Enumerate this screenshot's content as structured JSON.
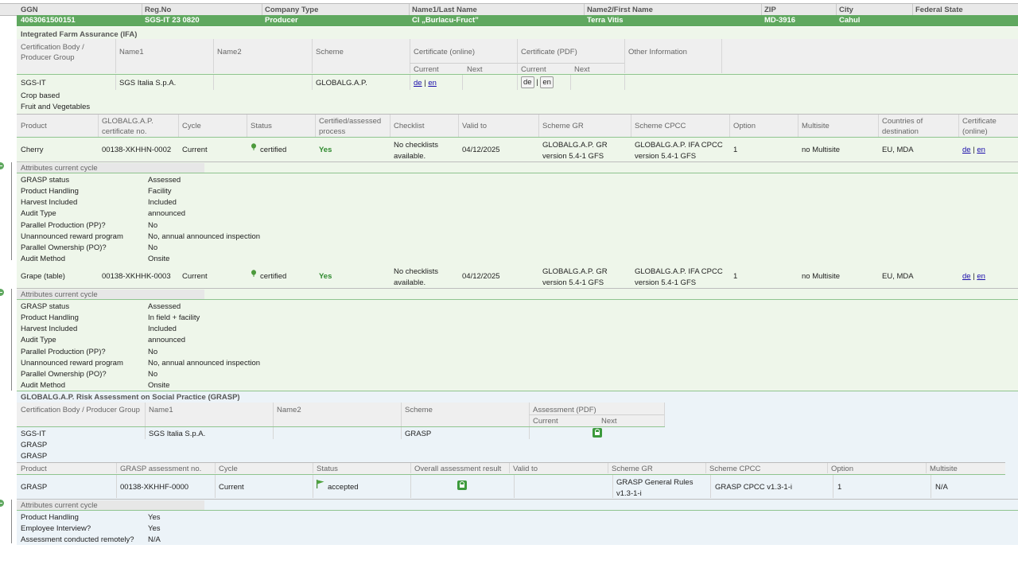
{
  "header": {
    "cols": [
      "GGN",
      "Reg.No",
      "Company Type",
      "Name1/Last Name",
      "Name2/First Name",
      "ZIP",
      "City",
      "Federal State"
    ]
  },
  "record": {
    "ggn": "4063061500151",
    "reg_no": "SGS-IT 23 0820",
    "company_type": "Producer",
    "name1": "CI „Burlacu-Fruct”",
    "name2": "Terra Vitis",
    "zip": "MD-3916",
    "city": "Cahul",
    "federal_state": ""
  },
  "ifa": {
    "title": "Integrated Farm Assurance (IFA)",
    "cols": {
      "cert_body": "Certification Body / Producer Group",
      "name1": "Name1",
      "name2": "Name2",
      "scheme": "Scheme",
      "cert_online": "Certificate (online)",
      "cert_pdf": "Certificate (PDF)",
      "other": "Other Information",
      "current": "Current",
      "next": "Next"
    },
    "row": {
      "cert_body": "SGS-IT",
      "name1": "SGS Italia S.p.A.",
      "name2": "",
      "scheme": "GLOBALG.A.P.",
      "online_de": "de",
      "online_en": "en",
      "pdf_de": "de",
      "pdf_en": "en",
      "sep": "|"
    },
    "sub1": "Crop based",
    "sub2": "Fruit and Vegetables",
    "prod_cols": {
      "product": "Product",
      "cert_no": "GLOBALG.A.P. certificate no.",
      "cycle": "Cycle",
      "status": "Status",
      "certified_process": "Certified/assessed process",
      "checklist": "Checklist",
      "valid_to": "Valid to",
      "scheme_gr": "Scheme GR",
      "scheme_cpcc": "Scheme CPCC",
      "option": "Option",
      "multisite": "Multisite",
      "countries": "Countries of destination",
      "certificate": "Certificate (online)"
    },
    "products": [
      {
        "product": "Cherry",
        "cert_no": "00138-XKHHN-0002",
        "cycle": "Current",
        "status": "certified",
        "process": "Yes",
        "checklist": "No checklists available.",
        "valid_to": "04/12/2025",
        "scheme_gr": "GLOBALG.A.P. GR version 5.4-1 GFS",
        "scheme_cpcc": "GLOBALG.A.P. IFA CPCC version 5.4-1 GFS",
        "option": "1",
        "multisite": "no Multisite",
        "countries": "EU, MDA",
        "de": "de",
        "en": "en",
        "sep": "|",
        "attr_title": "Attributes current cycle",
        "attrs": [
          [
            "GRASP status",
            "Assessed"
          ],
          [
            "Product Handling",
            "Facility"
          ],
          [
            "Harvest Included",
            "Included"
          ],
          [
            "Audit Type",
            "announced"
          ],
          [
            "Parallel Production (PP)?",
            "No"
          ],
          [
            "Unannounced reward program",
            "No, annual announced inspection"
          ],
          [
            "Parallel Ownership (PO)?",
            "No"
          ],
          [
            "Audit Method",
            "Onsite"
          ]
        ]
      },
      {
        "product": "Grape (table)",
        "cert_no": "00138-XKHHK-0003",
        "cycle": "Current",
        "status": "certified",
        "process": "Yes",
        "checklist": "No checklists available.",
        "valid_to": "04/12/2025",
        "scheme_gr": "GLOBALG.A.P. GR version 5.4-1 GFS",
        "scheme_cpcc": "GLOBALG.A.P. IFA CPCC version 5.4-1 GFS",
        "option": "1",
        "multisite": "no Multisite",
        "countries": "EU, MDA",
        "de": "de",
        "en": "en",
        "sep": "|",
        "attr_title": "Attributes current cycle",
        "attrs": [
          [
            "GRASP status",
            "Assessed"
          ],
          [
            "Product Handling",
            "In field + facility"
          ],
          [
            "Harvest Included",
            "Included"
          ],
          [
            "Audit Type",
            "announced"
          ],
          [
            "Parallel Production (PP)?",
            "No"
          ],
          [
            "Unannounced reward program",
            "No, annual announced inspection"
          ],
          [
            "Parallel Ownership (PO)?",
            "No"
          ],
          [
            "Audit Method",
            "Onsite"
          ]
        ]
      }
    ]
  },
  "grasp": {
    "title": "GLOBALG.A.P. Risk Assessment on Social Practice (GRASP)",
    "cols": {
      "cert_body": "Certification Body / Producer Group",
      "name1": "Name1",
      "name2": "Name2",
      "scheme": "Scheme",
      "assessment_pdf": "Assessment (PDF)",
      "current": "Current",
      "next": "Next"
    },
    "row": {
      "cert_body": "SGS-IT",
      "name1": "SGS Italia S.p.A.",
      "name2": "",
      "scheme": "GRASP"
    },
    "sub1": "GRASP",
    "sub2": "GRASP",
    "prod_cols": {
      "product": "Product",
      "assess_no": "GRASP assessment no.",
      "cycle": "Cycle",
      "status": "Status",
      "overall": "Overall assessment result",
      "valid_to": "Valid to",
      "scheme_gr": "Scheme GR",
      "scheme_cpcc": "Scheme CPCC",
      "option": "Option",
      "multisite": "Multisite"
    },
    "product": {
      "product": "GRASP",
      "assess_no": "00138-XKHHF-0000",
      "cycle": "Current",
      "status": "accepted",
      "valid_to": "",
      "scheme_gr": "GRASP General Rules v1.3-1-i",
      "scheme_cpcc": "GRASP CPCC v1.3-1-i",
      "option": "1",
      "multisite": "N/A"
    },
    "attr_title": "Attributes current cycle",
    "attrs": [
      [
        "Product Handling",
        "Yes"
      ],
      [
        "Employee Interview?",
        "Yes"
      ],
      [
        "Assessment conducted remotely?",
        "N/A"
      ]
    ]
  },
  "colors": {
    "accent": "#5fa85f",
    "row_green": "#eef6ea",
    "row_blue": "#ecf3f8",
    "yes": "#2f8a2f",
    "link": "#1a0dab"
  },
  "icons": {
    "certified": "leaf-icon",
    "accepted": "flag-icon",
    "pdf": "lock-icon",
    "collapse": "minus-circle-icon"
  }
}
